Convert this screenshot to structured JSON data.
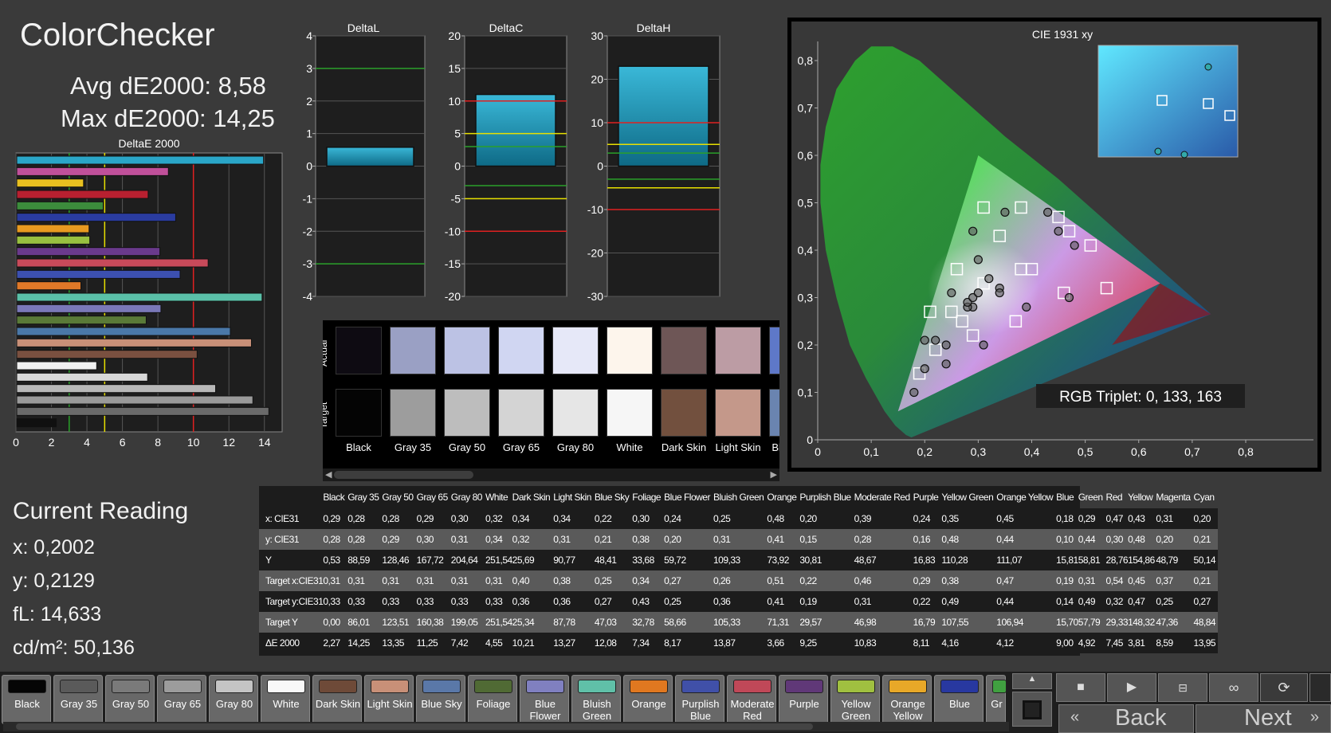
{
  "app": {
    "title": "ColorChecker",
    "avg": "Avg dE2000: 8,58",
    "max": "Max dE2000: 14,25"
  },
  "deltae_chart": {
    "title": "DeltaE 2000",
    "x_ticks": [
      "0",
      "2",
      "4",
      "6",
      "8",
      "10",
      "12",
      "14"
    ],
    "xlim": [
      0,
      15
    ],
    "threshold_lines": [
      {
        "value": 3,
        "color": "#2aa02a"
      },
      {
        "value": 5,
        "color": "#e8e000"
      },
      {
        "value": 10,
        "color": "#e02020"
      }
    ],
    "bars": [
      {
        "value": 13.95,
        "color": "#2aa6c8"
      },
      {
        "value": 8.59,
        "color": "#c0509a"
      },
      {
        "value": 3.81,
        "color": "#e8c020"
      },
      {
        "value": 7.45,
        "color": "#b82030"
      },
      {
        "value": 4.92,
        "color": "#3c8c3c"
      },
      {
        "value": 9.0,
        "color": "#2a3ca0"
      },
      {
        "value": 4.12,
        "color": "#e89a20"
      },
      {
        "value": 4.16,
        "color": "#98c040"
      },
      {
        "value": 8.11,
        "color": "#6a3a8c"
      },
      {
        "value": 10.83,
        "color": "#c84a5a"
      },
      {
        "value": 9.25,
        "color": "#3c50b0"
      },
      {
        "value": 3.66,
        "color": "#e07828"
      },
      {
        "value": 13.87,
        "color": "#5ac0a8"
      },
      {
        "value": 8.17,
        "color": "#7a78b8"
      },
      {
        "value": 7.34,
        "color": "#5a7a38"
      },
      {
        "value": 12.08,
        "color": "#4a78a8"
      },
      {
        "value": 13.27,
        "color": "#c89078"
      },
      {
        "value": 10.21,
        "color": "#7a5040"
      },
      {
        "value": 4.55,
        "color": "#f0f0f0"
      },
      {
        "value": 7.42,
        "color": "#d8d8d8"
      },
      {
        "value": 11.25,
        "color": "#b8b8b8"
      },
      {
        "value": 13.35,
        "color": "#9a9a9a"
      },
      {
        "value": 14.25,
        "color": "#6a6a6a"
      },
      {
        "value": 2.27,
        "color": "#101010"
      }
    ]
  },
  "delta_charts": [
    {
      "title": "DeltaL",
      "ymin": -4,
      "ymax": 4,
      "ticks": [
        "4",
        "3",
        "2",
        "1",
        "0",
        "-1",
        "-2",
        "-3",
        "-4"
      ],
      "bar": {
        "low": 0,
        "high": 0.58
      },
      "lines": [
        {
          "value": 3,
          "color": "#2aa02a"
        },
        {
          "value": -3,
          "color": "#2aa02a"
        }
      ]
    },
    {
      "title": "DeltaC",
      "ymin": -20,
      "ymax": 20,
      "ticks": [
        "20",
        "15",
        "10",
        "5",
        "0",
        "-5",
        "-10",
        "-15",
        "-20"
      ],
      "bar": {
        "low": 0,
        "high": 11
      },
      "lines": [
        {
          "value": 10,
          "color": "#e02020"
        },
        {
          "value": 5,
          "color": "#e8e000"
        },
        {
          "value": 3,
          "color": "#2aa02a"
        },
        {
          "value": -3,
          "color": "#2aa02a"
        },
        {
          "value": -5,
          "color": "#e8e000"
        },
        {
          "value": -10,
          "color": "#e02020"
        }
      ]
    },
    {
      "title": "DeltaH",
      "ymin": -30,
      "ymax": 30,
      "ticks": [
        "30",
        "20",
        "10",
        "0",
        "-10",
        "-20",
        "-30"
      ],
      "bar": {
        "low": 0,
        "high": 23
      },
      "lines": [
        {
          "value": 10,
          "color": "#e02020"
        },
        {
          "value": 5,
          "color": "#e8e000"
        },
        {
          "value": 3,
          "color": "#2aa02a"
        },
        {
          "value": -3,
          "color": "#2aa02a"
        },
        {
          "value": -5,
          "color": "#e8e000"
        },
        {
          "value": -10,
          "color": "#e02020"
        }
      ]
    }
  ],
  "swatches": {
    "actual_label": "Actual",
    "target_label": "Target",
    "items": [
      {
        "name": "Black",
        "actual": "#0e0b12",
        "target": "#040404"
      },
      {
        "name": "Gray 35",
        "actual": "#9aa0c4",
        "target": "#9d9d9d"
      },
      {
        "name": "Gray 50",
        "actual": "#bcc2e4",
        "target": "#bdbdbd"
      },
      {
        "name": "Gray 65",
        "actual": "#d0d6f2",
        "target": "#d4d4d4"
      },
      {
        "name": "Gray 80",
        "actual": "#e6e8f8",
        "target": "#e6e6e6"
      },
      {
        "name": "White",
        "actual": "#fdf5ec",
        "target": "#f6f6f6"
      },
      {
        "name": "Dark Skin",
        "actual": "#6e5656",
        "target": "#72503e"
      },
      {
        "name": "Light Skin",
        "actual": "#bc9ca4",
        "target": "#c4988a"
      },
      {
        "name": "Blue Sky",
        "actual": "#5e78c8",
        "target": "#6a84b0"
      }
    ]
  },
  "chromaticity": {
    "title": "CIE 1931 xy",
    "x_ticks": [
      "0",
      "0,1",
      "0,2",
      "0,3",
      "0,4",
      "0,5",
      "0,6",
      "0,7",
      "0,8"
    ],
    "y_ticks": [
      "0",
      "0,1",
      "0,2",
      "0,3",
      "0,4",
      "0,5",
      "0,6",
      "0,7",
      "0,8"
    ],
    "xlim": [
      0,
      0.8
    ],
    "ylim": [
      0,
      0.8
    ],
    "rgb_triplet": "RGB Triplet: 0, 133, 163",
    "gamut": [
      [
        0.64,
        0.33
      ],
      [
        0.3,
        0.6
      ],
      [
        0.15,
        0.06
      ]
    ],
    "targets": [
      [
        0.31,
        0.33
      ],
      [
        0.4,
        0.36
      ],
      [
        0.38,
        0.36
      ],
      [
        0.25,
        0.27
      ],
      [
        0.34,
        0.43
      ],
      [
        0.27,
        0.25
      ],
      [
        0.51,
        0.41
      ],
      [
        0.22,
        0.19
      ],
      [
        0.46,
        0.31
      ],
      [
        0.29,
        0.22
      ],
      [
        0.38,
        0.49
      ],
      [
        0.47,
        0.44
      ],
      [
        0.19,
        0.14
      ],
      [
        0.31,
        0.49
      ],
      [
        0.54,
        0.32
      ],
      [
        0.45,
        0.47
      ],
      [
        0.37,
        0.25
      ],
      [
        0.21,
        0.27
      ],
      [
        0.26,
        0.36
      ]
    ],
    "actuals": [
      [
        0.29,
        0.28
      ],
      [
        0.28,
        0.28
      ],
      [
        0.28,
        0.29
      ],
      [
        0.29,
        0.3
      ],
      [
        0.3,
        0.31
      ],
      [
        0.32,
        0.34
      ],
      [
        0.34,
        0.32
      ],
      [
        0.34,
        0.31
      ],
      [
        0.22,
        0.21
      ],
      [
        0.3,
        0.38
      ],
      [
        0.24,
        0.2
      ],
      [
        0.25,
        0.31
      ],
      [
        0.48,
        0.41
      ],
      [
        0.2,
        0.15
      ],
      [
        0.39,
        0.28
      ],
      [
        0.24,
        0.16
      ],
      [
        0.35,
        0.48
      ],
      [
        0.45,
        0.44
      ],
      [
        0.18,
        0.1
      ],
      [
        0.29,
        0.44
      ],
      [
        0.47,
        0.3
      ],
      [
        0.43,
        0.48
      ],
      [
        0.31,
        0.2
      ],
      [
        0.2,
        0.21
      ]
    ],
    "inset_points": [
      [
        0.2,
        0.21
      ],
      [
        0.22,
        0.2
      ],
      [
        0.21,
        0.22
      ]
    ]
  },
  "current_reading": {
    "title": "Current Reading",
    "x": "x: 0,2002",
    "y": "y: 0,2129",
    "fl": "fL: 14,633",
    "cd": "cd/m²: 50,136"
  },
  "table": {
    "columns": [
      "Black",
      "Gray 35",
      "Gray 50",
      "Gray 65",
      "Gray 80",
      "White",
      "Dark Skin",
      "Light Skin",
      "Blue Sky",
      "Foliage",
      "Blue Flower",
      "Bluish Green",
      "Orange",
      "Purplish Blue",
      "Moderate Red",
      "Purple",
      "Yellow Green",
      "Orange Yellow",
      "Blue",
      "Green",
      "Red",
      "Yellow",
      "Magenta",
      "Cyan"
    ],
    "rows": [
      {
        "label": "x: CIE31",
        "values": [
          "0,29",
          "0,28",
          "0,28",
          "0,29",
          "0,30",
          "0,32",
          "0,34",
          "0,34",
          "0,22",
          "0,30",
          "0,24",
          "0,25",
          "0,48",
          "0,20",
          "0,39",
          "0,24",
          "0,35",
          "0,45",
          "0,18",
          "0,29",
          "0,47",
          "0,43",
          "0,31",
          "0,20"
        ]
      },
      {
        "label": "y: CIE31",
        "values": [
          "0,28",
          "0,28",
          "0,29",
          "0,30",
          "0,31",
          "0,34",
          "0,32",
          "0,31",
          "0,21",
          "0,38",
          "0,20",
          "0,31",
          "0,41",
          "0,15",
          "0,28",
          "0,16",
          "0,48",
          "0,44",
          "0,10",
          "0,44",
          "0,30",
          "0,48",
          "0,20",
          "0,21"
        ]
      },
      {
        "label": "Y",
        "values": [
          "0,53",
          "88,59",
          "128,46",
          "167,72",
          "204,64",
          "251,54",
          "25,69",
          "90,77",
          "48,41",
          "33,68",
          "59,72",
          "109,33",
          "73,92",
          "30,81",
          "48,67",
          "16,83",
          "110,28",
          "111,07",
          "15,81",
          "58,81",
          "28,76",
          "154,86",
          "48,79",
          "50,14"
        ]
      },
      {
        "label": "Target x:CIE31",
        "values": [
          "0,31",
          "0,31",
          "0,31",
          "0,31",
          "0,31",
          "0,31",
          "0,40",
          "0,38",
          "0,25",
          "0,34",
          "0,27",
          "0,26",
          "0,51",
          "0,22",
          "0,46",
          "0,29",
          "0,38",
          "0,47",
          "0,19",
          "0,31",
          "0,54",
          "0,45",
          "0,37",
          "0,21"
        ]
      },
      {
        "label": "Target y:CIE31",
        "values": [
          "0,33",
          "0,33",
          "0,33",
          "0,33",
          "0,33",
          "0,33",
          "0,36",
          "0,36",
          "0,27",
          "0,43",
          "0,25",
          "0,36",
          "0,41",
          "0,19",
          "0,31",
          "0,22",
          "0,49",
          "0,44",
          "0,14",
          "0,49",
          "0,32",
          "0,47",
          "0,25",
          "0,27"
        ]
      },
      {
        "label": "Target Y",
        "values": [
          "0,00",
          "86,01",
          "123,51",
          "160,38",
          "199,05",
          "251,54",
          "25,34",
          "87,78",
          "47,03",
          "32,78",
          "58,66",
          "105,33",
          "71,31",
          "29,57",
          "46,98",
          "16,79",
          "107,55",
          "106,94",
          "15,70",
          "57,79",
          "29,33",
          "148,32",
          "47,36",
          "48,84"
        ]
      },
      {
        "label": "ΔE 2000",
        "values": [
          "2,27",
          "14,25",
          "13,35",
          "11,25",
          "7,42",
          "4,55",
          "10,21",
          "13,27",
          "12,08",
          "7,34",
          "8,17",
          "13,87",
          "3,66",
          "9,25",
          "10,83",
          "8,11",
          "4,16",
          "4,12",
          "9,00",
          "4,92",
          "7,45",
          "3,81",
          "8,59",
          "13,95"
        ]
      }
    ]
  },
  "patch_buttons": [
    {
      "label": "Black",
      "color": "#050505"
    },
    {
      "label": "Gray 35",
      "color": "#5a5a5a"
    },
    {
      "label": "Gray 50",
      "color": "#7a7a7a"
    },
    {
      "label": "Gray 65",
      "color": "#9c9c9c"
    },
    {
      "label": "Gray 80",
      "color": "#c4c4c4"
    },
    {
      "label": "White",
      "color": "#f8f8f8"
    },
    {
      "label": "Dark Skin",
      "color": "#6e4a38"
    },
    {
      "label": "Light Skin",
      "color": "#c89078"
    },
    {
      "label": "Blue Sky",
      "color": "#5a78a8"
    },
    {
      "label": "Foliage",
      "color": "#506a34"
    },
    {
      "label": "Blue Flower",
      "color": "#8080c0"
    },
    {
      "label": "Bluish Green",
      "color": "#60c0a8"
    },
    {
      "label": "Orange",
      "color": "#e07820"
    },
    {
      "label": "Purplish Blue",
      "color": "#4050a8"
    },
    {
      "label": "Moderate Red",
      "color": "#c04858"
    },
    {
      "label": "Purple",
      "color": "#603878"
    },
    {
      "label": "Yellow Green",
      "color": "#a0c040"
    },
    {
      "label": "Orange Yellow",
      "color": "#e8a828"
    },
    {
      "label": "Blue",
      "color": "#2838a0"
    },
    {
      "label": "Gr",
      "color": "#40a040"
    }
  ],
  "controls": {
    "back": "Back",
    "next": "Next"
  }
}
